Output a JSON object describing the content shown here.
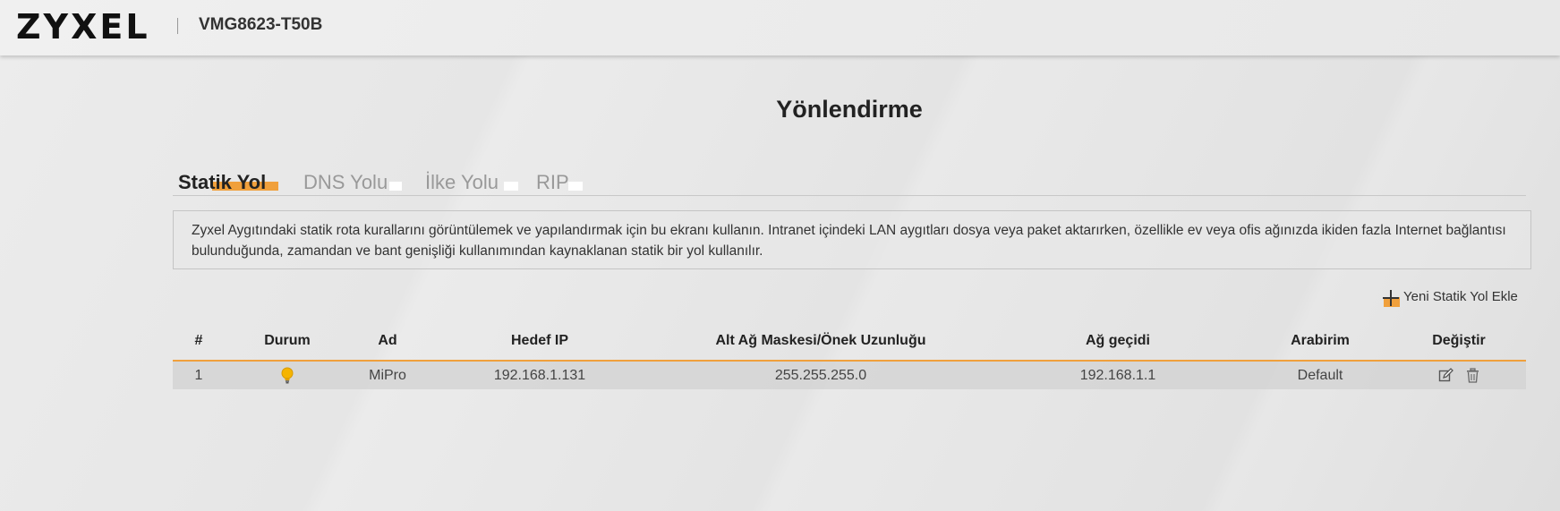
{
  "header": {
    "logo": "ZYXEL",
    "model": "VMG8623-T50B"
  },
  "page": {
    "title": "Yönlendirme"
  },
  "tabs": [
    {
      "label": "Statik Yol",
      "active": true
    },
    {
      "label": "DNS Yolu",
      "active": false
    },
    {
      "label": "İlke Yolu",
      "active": false
    },
    {
      "label": "RIP",
      "active": false
    }
  ],
  "info": {
    "text": "Zyxel Aygıtındaki statik rota kurallarını görüntülemek ve yapılandırmak için bu ekranı kullanın. Intranet içindeki LAN aygıtları dosya veya paket aktarırken, özellikle ev veya ofis ağınızda ikiden fazla Internet bağlantısı bulunduğunda, zamandan ve bant genişliği kullanımından kaynaklanan statik bir yol kullanılır."
  },
  "add_button": {
    "label": "Yeni Statik Yol Ekle",
    "icon": "plus-icon"
  },
  "table": {
    "headers": [
      "#",
      "Durum",
      "Ad",
      "Hedef IP",
      "Alt Ağ Maskesi/Önek Uzunluğu",
      "Ağ geçidi",
      "Arabirim",
      "Değiştir"
    ],
    "rows": [
      {
        "index": "1",
        "status_icon": "bulb-on-icon",
        "name": "MiPro",
        "destination_ip": "192.168.1.131",
        "subnet_mask": "255.255.255.0",
        "gateway": "192.168.1.1",
        "interface": "Default",
        "actions": [
          "edit-icon",
          "delete-icon"
        ]
      }
    ]
  },
  "colors": {
    "accent": "#f0a03c",
    "bulb": "#f5b400"
  }
}
